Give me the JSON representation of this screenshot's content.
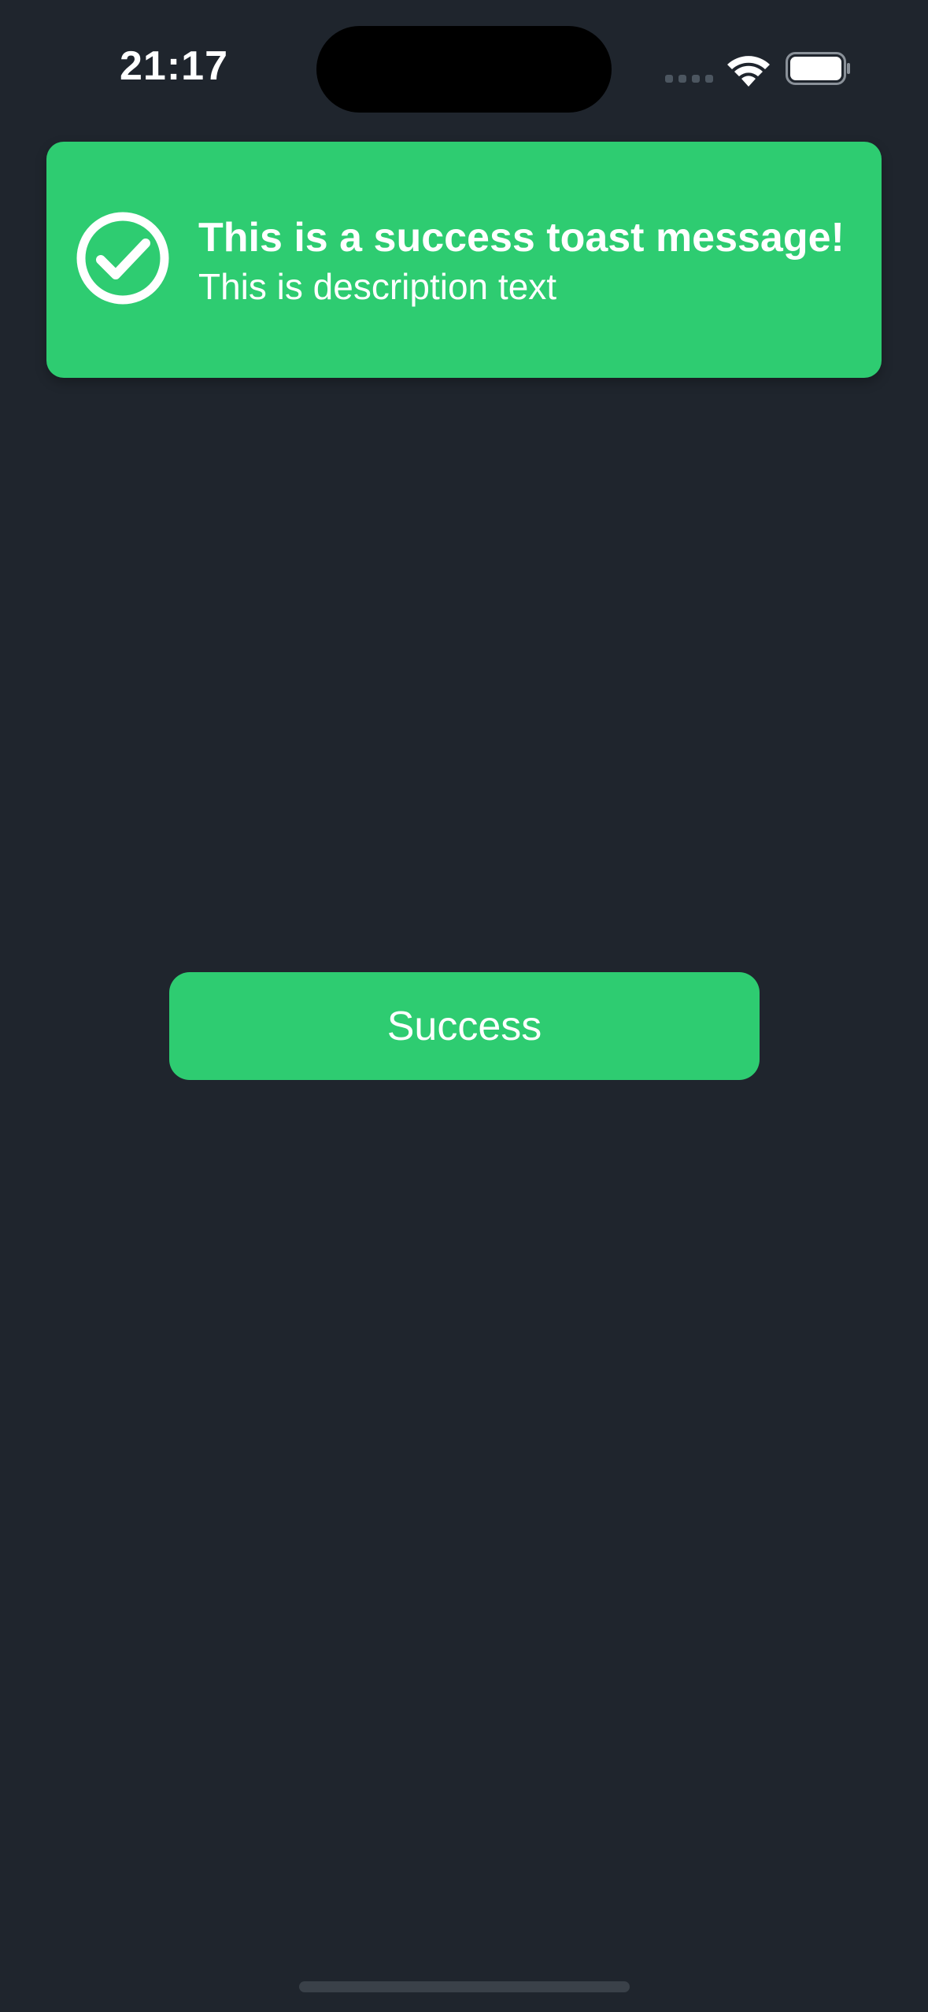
{
  "status_bar": {
    "time": "21:17",
    "icons": [
      "cellular-signal-icon",
      "wifi-icon",
      "battery-icon"
    ]
  },
  "toast": {
    "icon": "checkmark-circle-icon",
    "title": "This is a success toast message!",
    "description": "This is description text",
    "background_color": "#2ecc71"
  },
  "main": {
    "success_button_label": "Success",
    "button_color": "#2ecc71"
  },
  "theme": {
    "background": "#1f252d",
    "text": "#ffffff"
  }
}
